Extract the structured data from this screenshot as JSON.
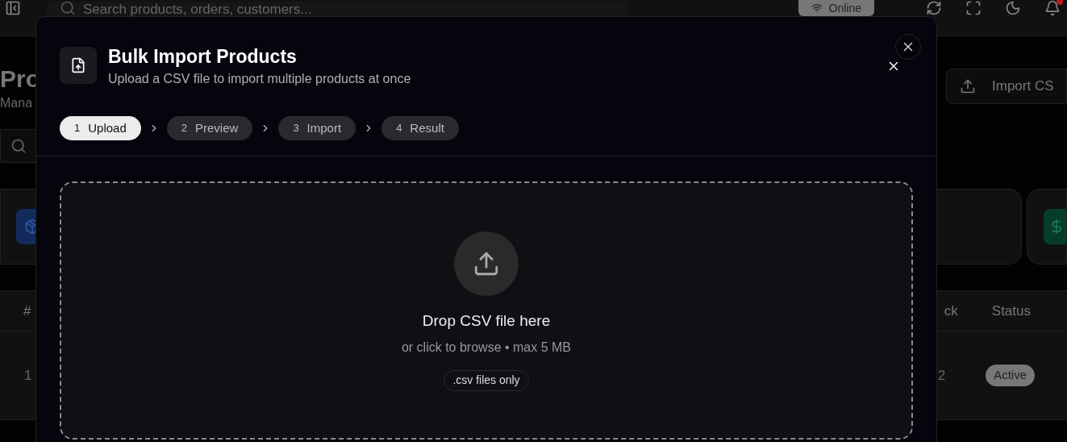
{
  "topbar": {
    "search": {
      "placeholder": "Search products, orders, customers..."
    },
    "status": "Online",
    "has_notification": true
  },
  "page": {
    "title": "Pro",
    "subtitle": "Mana",
    "import_button": "Import CS"
  },
  "table": {
    "columns": [
      "#",
      "ck",
      "Status"
    ],
    "rows": [
      {
        "index": "1",
        "stock": "2",
        "status": "Active"
      }
    ]
  },
  "modal": {
    "title": "Bulk Import Products",
    "subtitle": "Upload a CSV file to import multiple products at once",
    "steps": [
      {
        "number": "1",
        "label": "Upload",
        "selected": true
      },
      {
        "number": "2",
        "label": "Preview",
        "selected": false
      },
      {
        "number": "3",
        "label": "Import",
        "selected": false
      },
      {
        "number": "4",
        "label": "Result",
        "selected": false
      }
    ],
    "dropzone": {
      "heading": "Drop CSV file here",
      "hint": "or click to browse • max 5 MB",
      "badge": ".csv files only"
    }
  }
}
